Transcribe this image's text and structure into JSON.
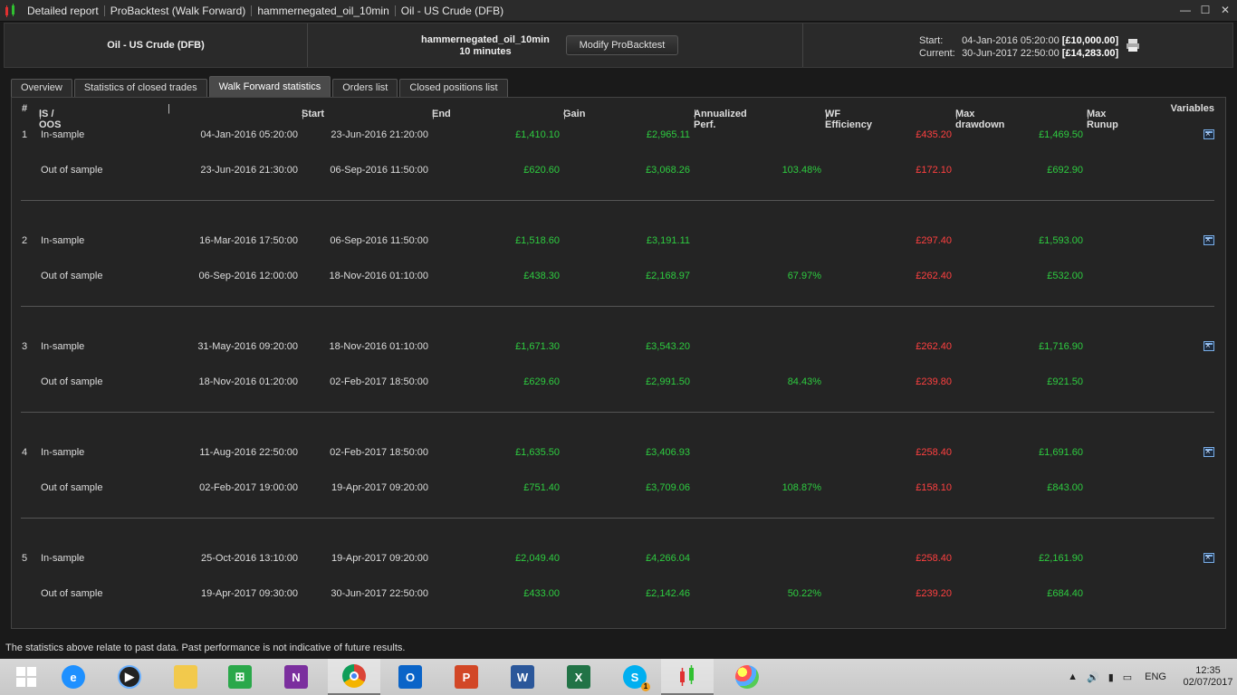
{
  "titlebar": {
    "crumbs": [
      "Detailed report",
      "ProBacktest (Walk Forward)",
      "hammernegated_oil_10min",
      "Oil - US Crude (DFB)"
    ]
  },
  "header": {
    "instrument": "Oil - US Crude (DFB)",
    "system_name": "hammernegated_oil_10min",
    "timeframe": "10 minutes",
    "modify_label": "Modify ProBacktest",
    "start_label": "Start:",
    "start_date": "04-Jan-2016 05:20:00",
    "start_value": "[£10,000.00]",
    "current_label": "Current:",
    "current_date": "30-Jun-2017 22:50:00",
    "current_value": "[£14,283.00]"
  },
  "tabs": [
    "Overview",
    "Statistics of closed trades",
    "Walk Forward statistics",
    "Orders list",
    "Closed positions list"
  ],
  "active_tab": "Walk Forward statistics",
  "columns": {
    "num": "#",
    "isoos": "IS / OOS",
    "start": "Start",
    "end": "End",
    "gain": "Gain",
    "annualized": "Annualized Perf.",
    "wf": "WF Efficiency",
    "drawdown": "Max drawdown",
    "runup": "Max Runup",
    "variables": "Variables"
  },
  "runs": [
    {
      "num": "1",
      "is": {
        "type": "In-sample",
        "start": "04-Jan-2016 05:20:00",
        "end": "23-Jun-2016 21:20:00",
        "gain": "£1,410.10",
        "annualized": "£2,965.11",
        "wf": "",
        "drawdown": "£435.20",
        "runup": "£1,469.50"
      },
      "oos": {
        "type": "Out of sample",
        "start": "23-Jun-2016 21:30:00",
        "end": "06-Sep-2016 11:50:00",
        "gain": "£620.60",
        "annualized": "£3,068.26",
        "wf": "103.48%",
        "drawdown": "£172.10",
        "runup": "£692.90"
      }
    },
    {
      "num": "2",
      "is": {
        "type": "In-sample",
        "start": "16-Mar-2016 17:50:00",
        "end": "06-Sep-2016 11:50:00",
        "gain": "£1,518.60",
        "annualized": "£3,191.11",
        "wf": "",
        "drawdown": "£297.40",
        "runup": "£1,593.00"
      },
      "oos": {
        "type": "Out of sample",
        "start": "06-Sep-2016 12:00:00",
        "end": "18-Nov-2016 01:10:00",
        "gain": "£438.30",
        "annualized": "£2,168.97",
        "wf": "67.97%",
        "drawdown": "£262.40",
        "runup": "£532.00"
      }
    },
    {
      "num": "3",
      "is": {
        "type": "In-sample",
        "start": "31-May-2016 09:20:00",
        "end": "18-Nov-2016 01:10:00",
        "gain": "£1,671.30",
        "annualized": "£3,543.20",
        "wf": "",
        "drawdown": "£262.40",
        "runup": "£1,716.90"
      },
      "oos": {
        "type": "Out of sample",
        "start": "18-Nov-2016 01:20:00",
        "end": "02-Feb-2017 18:50:00",
        "gain": "£629.60",
        "annualized": "£2,991.50",
        "wf": "84.43%",
        "drawdown": "£239.80",
        "runup": "£921.50"
      }
    },
    {
      "num": "4",
      "is": {
        "type": "In-sample",
        "start": "11-Aug-2016 22:50:00",
        "end": "02-Feb-2017 18:50:00",
        "gain": "£1,635.50",
        "annualized": "£3,406.93",
        "wf": "",
        "drawdown": "£258.40",
        "runup": "£1,691.60"
      },
      "oos": {
        "type": "Out of sample",
        "start": "02-Feb-2017 19:00:00",
        "end": "19-Apr-2017 09:20:00",
        "gain": "£751.40",
        "annualized": "£3,709.06",
        "wf": "108.87%",
        "drawdown": "£158.10",
        "runup": "£843.00"
      }
    },
    {
      "num": "5",
      "is": {
        "type": "In-sample",
        "start": "25-Oct-2016 13:10:00",
        "end": "19-Apr-2017 09:20:00",
        "gain": "£2,049.40",
        "annualized": "£4,266.04",
        "wf": "",
        "drawdown": "£258.40",
        "runup": "£2,161.90"
      },
      "oos": {
        "type": "Out of sample",
        "start": "19-Apr-2017 09:30:00",
        "end": "30-Jun-2017 22:50:00",
        "gain": "£433.00",
        "annualized": "£2,142.46",
        "wf": "50.22%",
        "drawdown": "£239.20",
        "runup": "£684.40"
      }
    }
  ],
  "footer_note": "The statistics above relate to past data. Past performance is not indicative of future results.",
  "taskbar": {
    "apps": [
      "start-icon",
      "internet-explorer-icon",
      "media-player-icon",
      "file-explorer-icon",
      "store-icon",
      "onenote-icon",
      "chrome-icon",
      "outlook-icon",
      "powerpoint-icon",
      "word-icon",
      "excel-icon",
      "skype-icon",
      "prorealtime-icon",
      "paint-icon"
    ],
    "language": "ENG",
    "time": "12:35",
    "date": "02/07/2017",
    "skype_badge": "1"
  },
  "colors": {
    "positive": "#2ecc40",
    "negative": "#ff4040",
    "background": "#242424"
  }
}
